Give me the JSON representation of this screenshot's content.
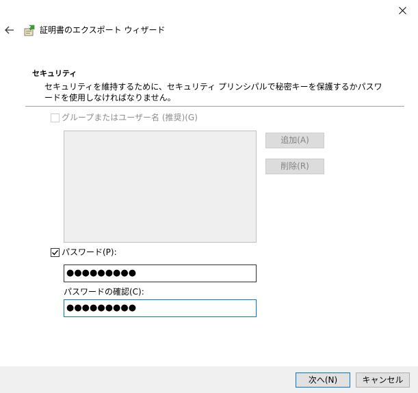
{
  "window": {
    "title": "証明書のエクスポート ウィザード",
    "icons": {
      "close": "close-icon",
      "back": "back-arrow-icon",
      "wizard": "certificate-icon"
    }
  },
  "section": {
    "title": "セキュリティ",
    "description": "セキュリティを維持するために、セキュリティ プリンシパルで秘密キーを保護するかパスワードを使用しなければなりません。"
  },
  "group_user": {
    "checkbox_label": "グループまたはユーザー名 (推奨)(G)",
    "checked": false,
    "enabled": false,
    "add_label": "追加(A)",
    "remove_label": "削除(R)"
  },
  "password": {
    "checkbox_label": "パスワード(P):",
    "checked": true,
    "value": "●●●●●●●●●",
    "confirm_label": "パスワードの確認(C):",
    "confirm_value": "●●●●●●●●●"
  },
  "footer": {
    "next_label": "次へ(N)",
    "cancel_label": "キャンセル"
  },
  "colors": {
    "focus_border": "#0078d7",
    "disabled_text": "#8c8c8c",
    "footer_bg": "#f0f0f0"
  }
}
